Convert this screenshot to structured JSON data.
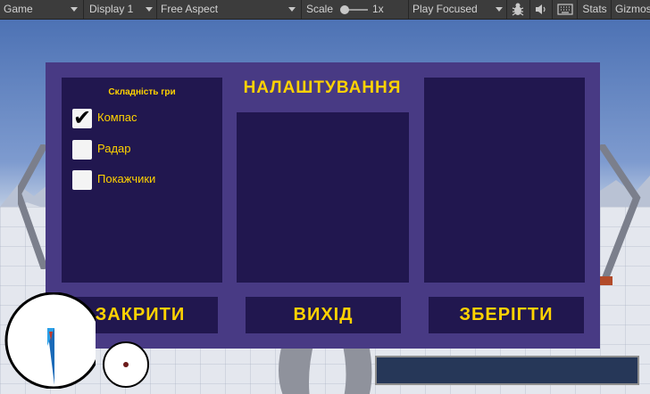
{
  "toolbar": {
    "game_tab": "Game",
    "display": "Display 1",
    "aspect": "Free Aspect",
    "scale_label": "Scale",
    "scale_value": "1x",
    "play_mode": "Play Focused",
    "stats": "Stats",
    "gizmos": "Gizmos"
  },
  "settings": {
    "title": "НАЛАШТУВАННЯ",
    "difficulty_title": "Складність гри",
    "options": [
      {
        "label": "Компас",
        "checked": true
      },
      {
        "label": "Радар",
        "checked": false
      },
      {
        "label": "Покажчики",
        "checked": false
      }
    ],
    "buttons": {
      "close": "ЗАКРИТИ",
      "exit": "ВИХІД",
      "save": "ЗБЕРІГТИ"
    }
  },
  "colors": {
    "panel": "#483a84",
    "box": "#21174f",
    "accent": "#ffd200"
  }
}
